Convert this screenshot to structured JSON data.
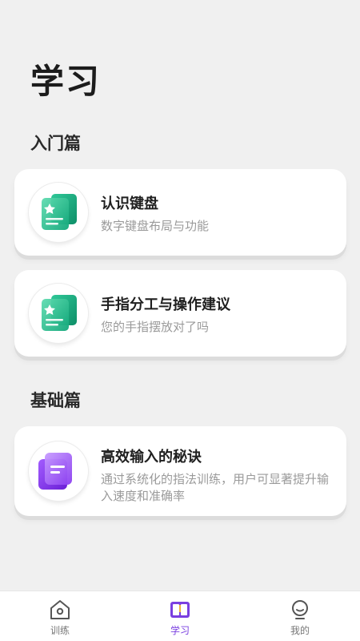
{
  "page": {
    "title": "学习"
  },
  "sections": [
    {
      "title": "入门篇"
    },
    {
      "title": "基础篇"
    }
  ],
  "cards": [
    {
      "title": "认识键盘",
      "subtitle": "数字键盘布局与功能",
      "icon": "document-star-icon"
    },
    {
      "title": "手指分工与操作建议",
      "subtitle": "您的手指摆放对了吗",
      "icon": "document-star-icon"
    },
    {
      "title": "高效输入的秘诀",
      "subtitle": "通过系统化的指法训练，用户可显著提升输入速度和准确率",
      "icon": "notebook-icon"
    }
  ],
  "tabbar": {
    "items": [
      {
        "label": "训练",
        "icon": "home-icon"
      },
      {
        "label": "学习",
        "icon": "book-icon",
        "active": true
      },
      {
        "label": "我的",
        "icon": "profile-icon"
      }
    ]
  },
  "colors": {
    "accent": "#7a3fe0",
    "green": "#1fbf8f",
    "purple": "#8a3cf0"
  }
}
